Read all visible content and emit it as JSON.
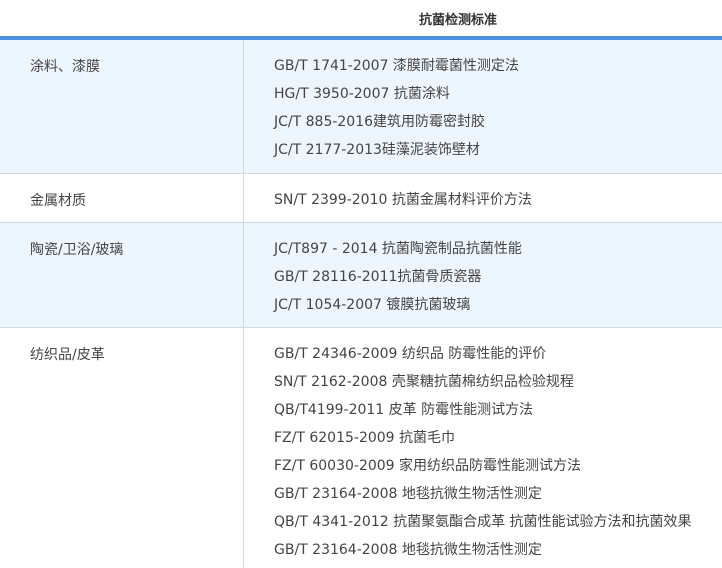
{
  "table": {
    "header": "抗菌检测标准",
    "rows": [
      {
        "category": "涂料、漆膜",
        "standards": [
          "GB/T 1741-2007 漆膜耐霉菌性测定法",
          "HG/T 3950-2007 抗菌涂料",
          "JC/T 885-2016建筑用防霉密封胶",
          "JC/T 2177-2013硅藻泥装饰壁材"
        ]
      },
      {
        "category": "金属材质",
        "standards": [
          "SN/T 2399-2010  抗菌金属材料评价方法"
        ]
      },
      {
        "category": "陶瓷/卫浴/玻璃",
        "standards": [
          "JC/T897 - 2014 抗菌陶瓷制品抗菌性能",
          "GB/T 28116-2011抗菌骨质瓷器",
          "JC/T 1054-2007 镀膜抗菌玻璃"
        ]
      },
      {
        "category": "纺织品/皮革",
        "standards": [
          "GB/T 24346-2009  纺织品 防霉性能的评价",
          "SN/T 2162-2008 壳聚糖抗菌棉纺织品检验规程",
          "QB/T4199-2011 皮革 防霉性能测试方法",
          "FZ/T 62015-2009 抗菌毛巾",
          "FZ/T 60030-2009 家用纺织品防霉性能测试方法",
          "GB/T 23164-2008 地毯抗微生物活性测定",
          "QB/T 4341-2012 抗菌聚氨酯合成革 抗菌性能试验方法和抗菌效果",
          "GB/T 23164-2008  地毯抗微生物活性测定"
        ]
      }
    ]
  }
}
